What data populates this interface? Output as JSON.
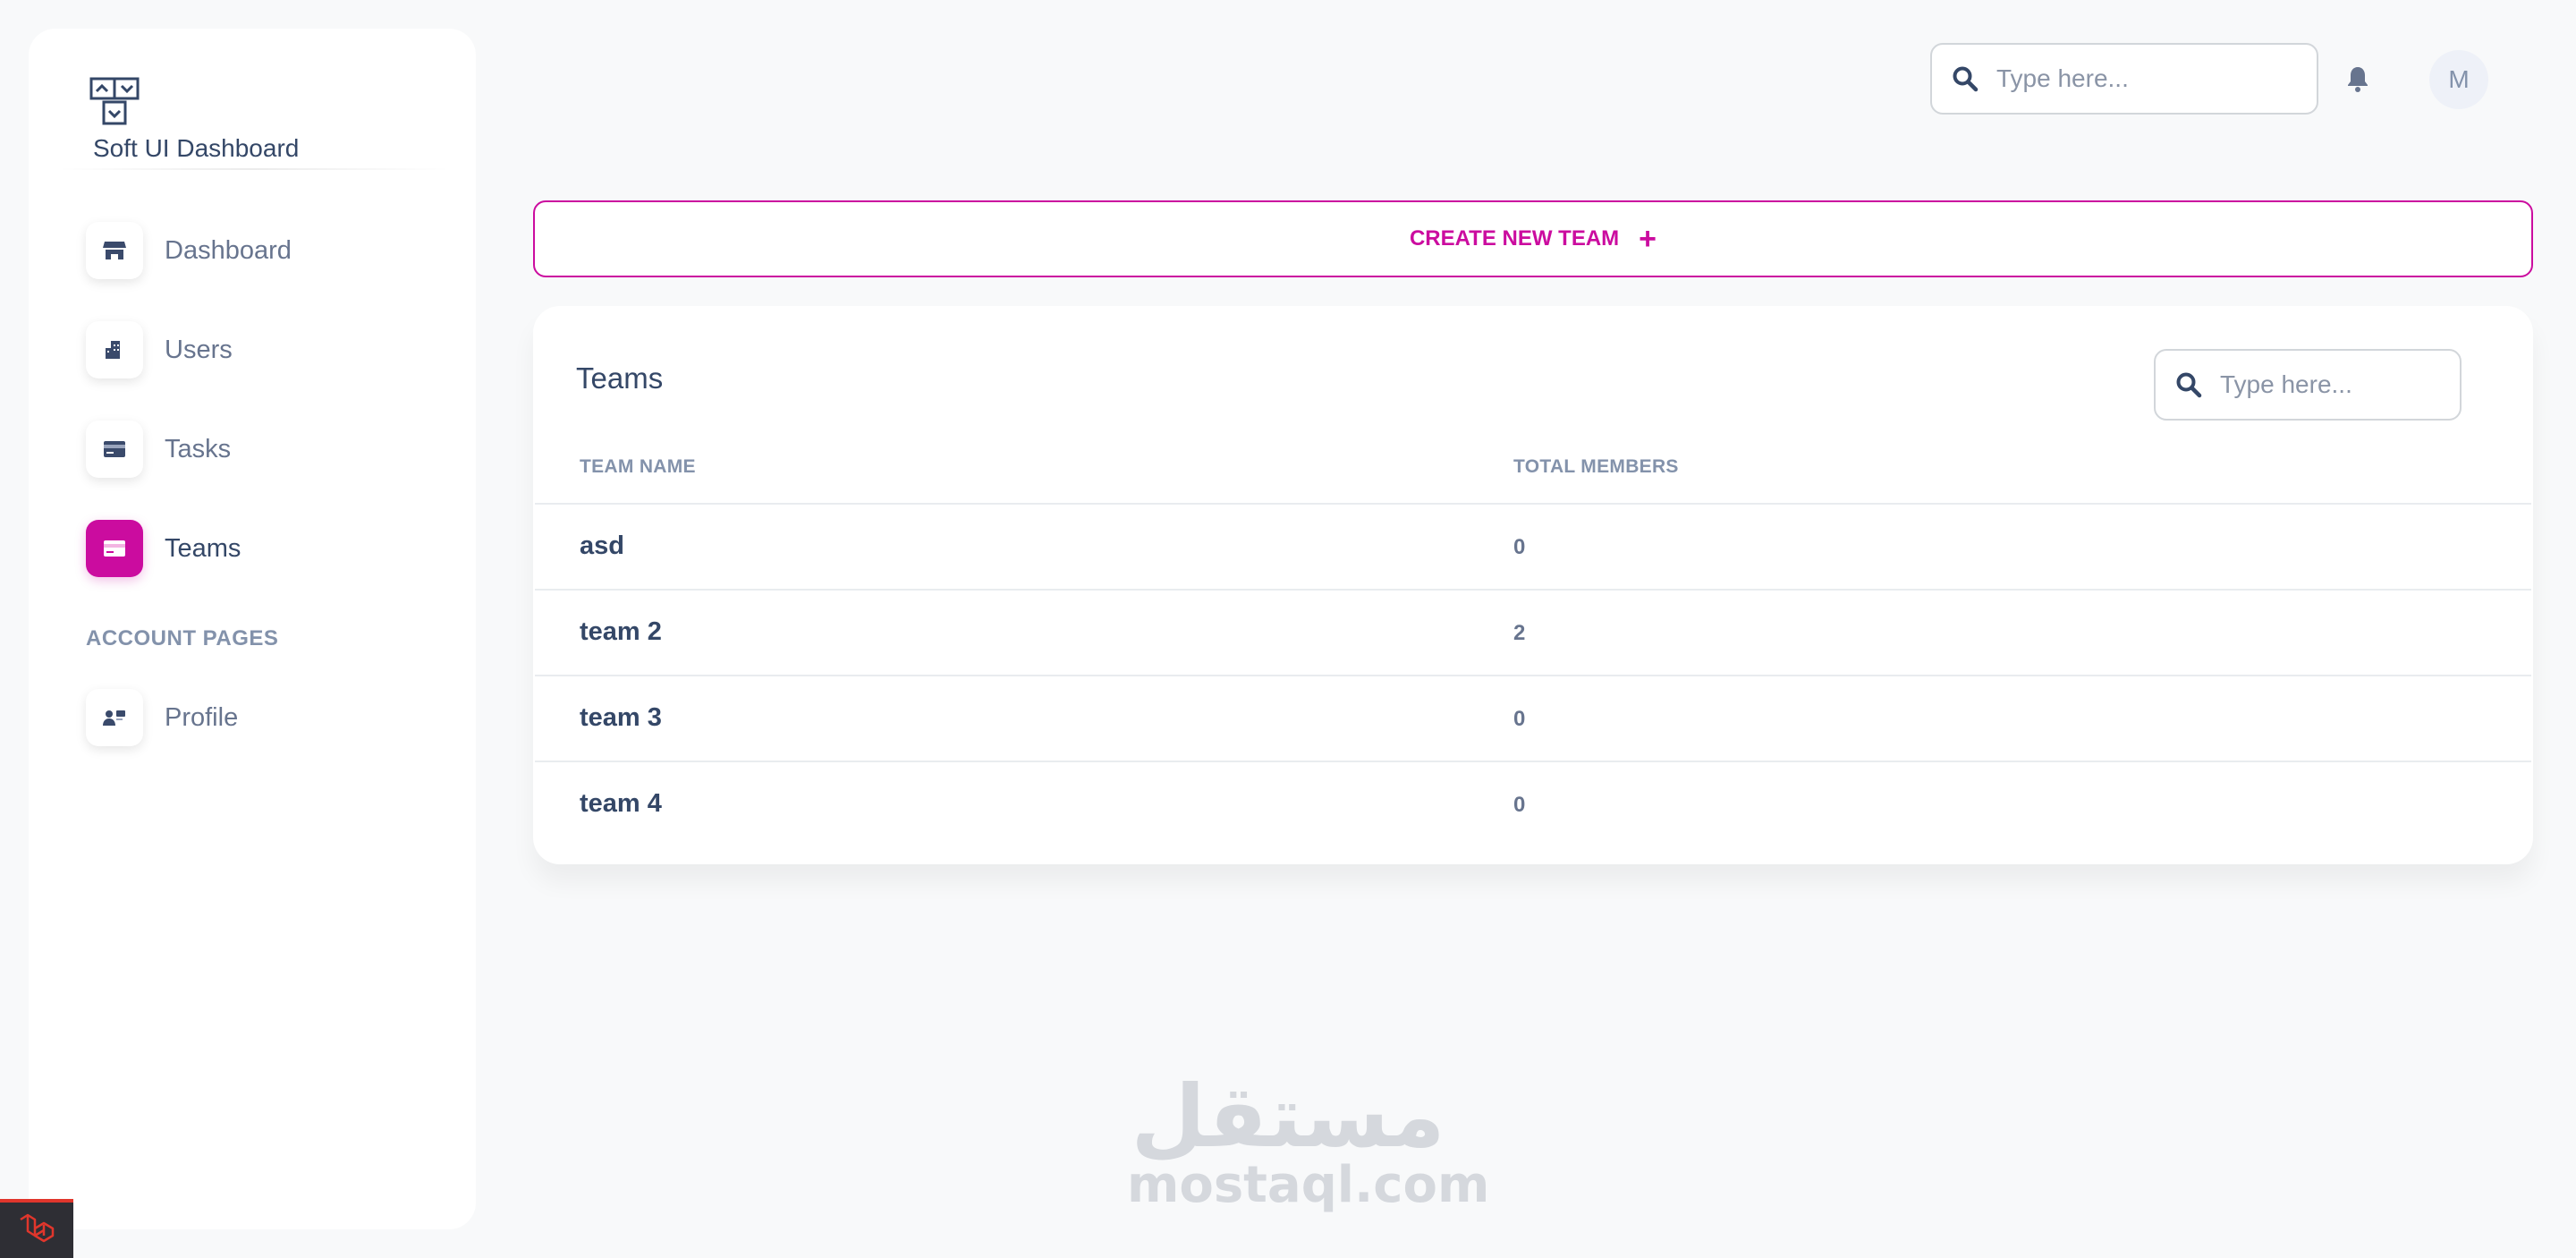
{
  "brand": {
    "name": "Soft UI Dashboard"
  },
  "sidebar": {
    "items": [
      {
        "label": "Dashboard",
        "icon": "shop-icon"
      },
      {
        "label": "Users",
        "icon": "office-icon"
      },
      {
        "label": "Tasks",
        "icon": "credit-card-icon"
      },
      {
        "label": "Teams",
        "icon": "credit-card-icon",
        "active": true
      }
    ],
    "section_title": "ACCOUNT PAGES",
    "account_items": [
      {
        "label": "Profile",
        "icon": "user-card-icon"
      }
    ]
  },
  "topbar": {
    "search_placeholder": "Type here...",
    "avatar_initial": "M"
  },
  "create_button": {
    "label": "CREATE NEW TEAM",
    "plus": "+"
  },
  "teams_card": {
    "title": "Teams",
    "search_placeholder": "Type here...",
    "columns": [
      "TEAM NAME",
      "TOTAL MEMBERS"
    ],
    "rows": [
      {
        "name": "asd",
        "members": "0"
      },
      {
        "name": "team 2",
        "members": "2"
      },
      {
        "name": "team 3",
        "members": "0"
      },
      {
        "name": "team 4",
        "members": "0"
      }
    ]
  },
  "watermark": {
    "arabic": "مستقل",
    "latin": "mostaql.com"
  },
  "colors": {
    "accent": "#cb0c9f",
    "text_dark": "#344767",
    "text_muted": "#67748e",
    "background": "#f8f9fa"
  }
}
